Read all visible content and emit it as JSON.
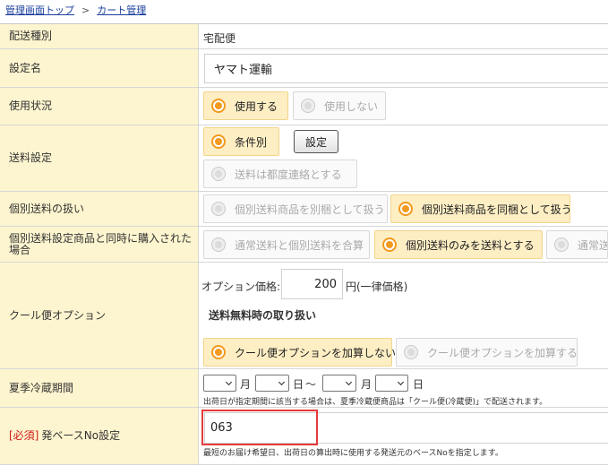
{
  "breadcrumb": {
    "home": "管理画面トップ",
    "separator": ">",
    "current": "カート管理"
  },
  "shipping_type": {
    "label": "配送種別",
    "value": "宅配便"
  },
  "setting_name": {
    "label": "設定名",
    "value": "ヤマト運輸"
  },
  "usage": {
    "label": "使用状況",
    "options": [
      "使用する",
      "使用しない"
    ],
    "selected": 0
  },
  "shipping_fee": {
    "label": "送料設定",
    "options": [
      "条件別",
      "送料は都度連絡とする"
    ],
    "selected": 0,
    "button": "設定"
  },
  "individual_fee": {
    "label": "個別送料の扱い",
    "options": [
      "個別送料商品を別梱として扱う",
      "個別送料商品を同梱として扱う"
    ],
    "selected": 1
  },
  "combined_purchase": {
    "label": "個別送料設定商品と同時に購入された場合",
    "options": [
      "通常送料と個別送料を合算",
      "個別送料のみを送料とする",
      "通常送"
    ],
    "selected": 1
  },
  "cool_option": {
    "label": "クール便オプション",
    "price_label": "オプション価格:",
    "price": "200",
    "price_unit": "円(一律価格)",
    "free_heading": "送料無料時の取り扱い",
    "options": [
      "クール便オプションを加算しない",
      "クール便オプションを加算する"
    ],
    "selected": 0
  },
  "summer_period": {
    "label": "夏季冷蔵期間",
    "month": "月",
    "day": "日",
    "tilde": "～",
    "note": "出荷日が指定期間に該当する場合は、夏季冷蔵便商品は「クール便(冷蔵便)」で配送されます。"
  },
  "origin_base": {
    "required": "[必須]",
    "label": "発ベースNo設定",
    "value": "063",
    "note": "最短のお届け希望日、出荷日の算出時に使用する発送元のベースNoを指定します。"
  }
}
